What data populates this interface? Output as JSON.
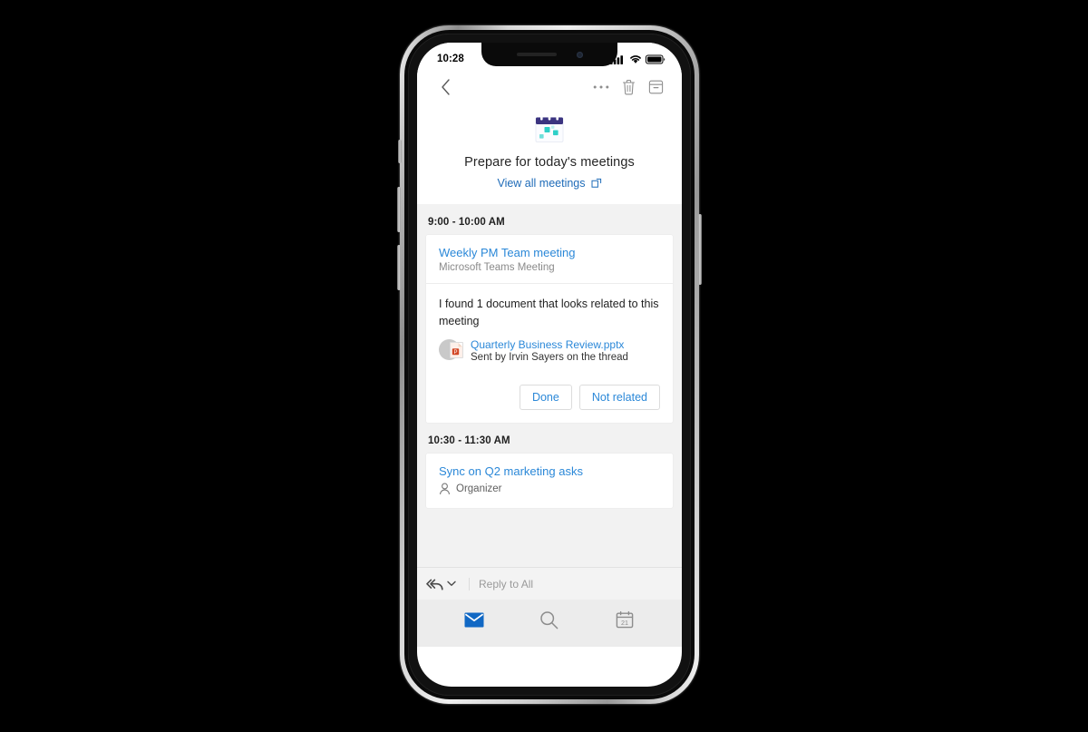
{
  "device": {
    "name": "smartphone-mockup"
  },
  "status_bar": {
    "time": "10:28",
    "icons": [
      "cellular-signal-icon",
      "wifi-icon",
      "battery-icon"
    ]
  },
  "toolbar": {
    "back_icon": "chevron-left-icon",
    "more_icon": "ellipsis-icon",
    "delete_icon": "trash-icon",
    "archive_icon": "archive-icon"
  },
  "hero": {
    "icon": "calendar-icon",
    "title": "Prepare for today's meetings",
    "link_label": "View all meetings",
    "link_icon": "open-external-icon"
  },
  "sections": [
    {
      "time_range": "9:00 - 10:00 AM",
      "meeting_title": "Weekly PM Team meeting",
      "meeting_subtitle": "Microsoft Teams Meeting",
      "suggestion_text": "I found 1 document that looks related to this meeting",
      "attachment": {
        "avatar_icon": "person-avatar",
        "file_icon": "powerpoint-file-icon",
        "file_name": "Quarterly Business Review.pptx",
        "sender_text": "Sent by Irvin Sayers on the thread"
      },
      "actions": [
        {
          "label": "Done",
          "name": "done-button"
        },
        {
          "label": "Not related",
          "name": "not-related-button"
        }
      ]
    },
    {
      "time_range": "10:30 - 11:30 AM",
      "meeting_title": "Sync on Q2 marketing asks",
      "organizer_icon": "person-icon",
      "organizer_label": "Organizer"
    }
  ],
  "reply_bar": {
    "reply_all_icon": "reply-all-icon",
    "chevron_icon": "chevron-down-icon",
    "placeholder": "Reply to All",
    "value": ""
  },
  "tabbar": {
    "items": [
      {
        "name": "tab-mail",
        "icon": "mail-icon",
        "active": true
      },
      {
        "name": "tab-search",
        "icon": "search-icon",
        "active": false
      },
      {
        "name": "tab-calendar",
        "icon": "calendar-day-icon",
        "active": false
      }
    ],
    "calendar_day": "21"
  },
  "colors": {
    "accent_blue": "#2b88d8",
    "link_blue": "#1e6bb8",
    "screen_bg": "#f2f2f2",
    "tabbar_bg": "#ececec"
  }
}
